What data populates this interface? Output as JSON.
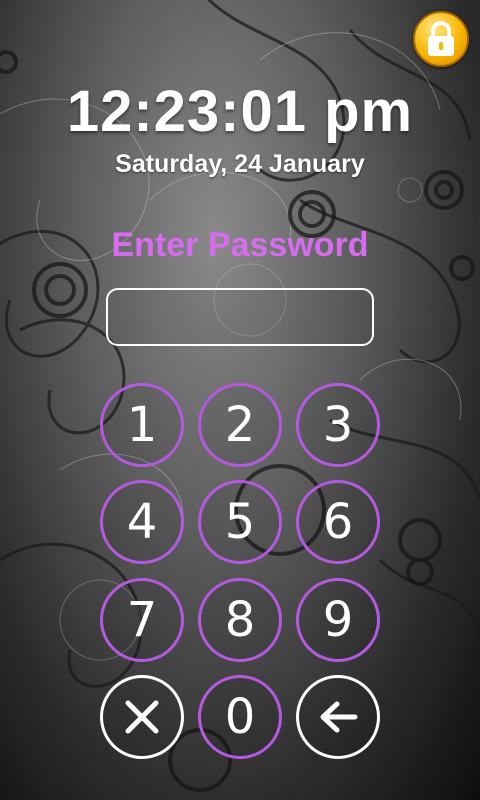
{
  "lock_screen": {
    "time": "12:23:01 pm",
    "date": "Saturday, 24 January",
    "prompt": "Enter Password",
    "password_value": ""
  },
  "keypad": {
    "keys": [
      "1",
      "2",
      "3",
      "4",
      "5",
      "6",
      "7",
      "8",
      "9"
    ],
    "zero": "0",
    "clear_icon": "x-icon",
    "backspace_icon": "arrow-left-icon"
  },
  "colors": {
    "accent": "#d86cf0",
    "key_border": "#b45ae0",
    "lock_icon_bg": "#f7b500"
  }
}
